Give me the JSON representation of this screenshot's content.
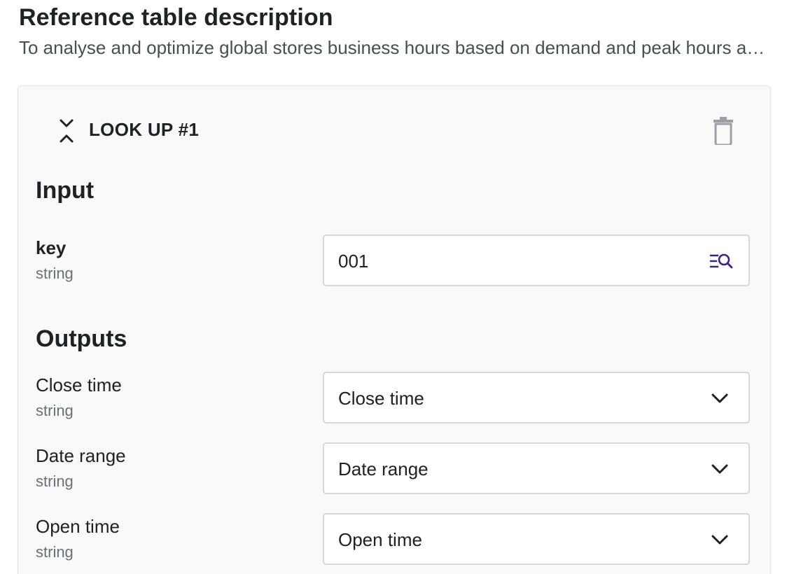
{
  "reference_table": {
    "title": "Reference table description",
    "description": "To analyse and optimize global stores business hours based on demand and peak hours across regions"
  },
  "lookup": {
    "title": "LOOK UP #1",
    "icons": {
      "collapse": "collapse-chevrons-icon",
      "delete": "trash-icon",
      "search_list": "list-search-icon",
      "dropdown": "chevron-down-icon"
    },
    "input_section": {
      "heading": "Input",
      "fields": [
        {
          "label": "key",
          "type": "string",
          "value": "001"
        }
      ]
    },
    "outputs_section": {
      "heading": "Outputs",
      "fields": [
        {
          "label": "Close time",
          "type": "string",
          "selected": "Close time"
        },
        {
          "label": "Date range",
          "type": "string",
          "selected": "Date range"
        },
        {
          "label": "Open time",
          "type": "string",
          "selected": "Open time"
        }
      ]
    }
  },
  "colors": {
    "accent": "#3d1f8f",
    "card_background": "#f9f9f9",
    "border": "#d5d7db",
    "icon_gray": "#9aa0a6"
  }
}
